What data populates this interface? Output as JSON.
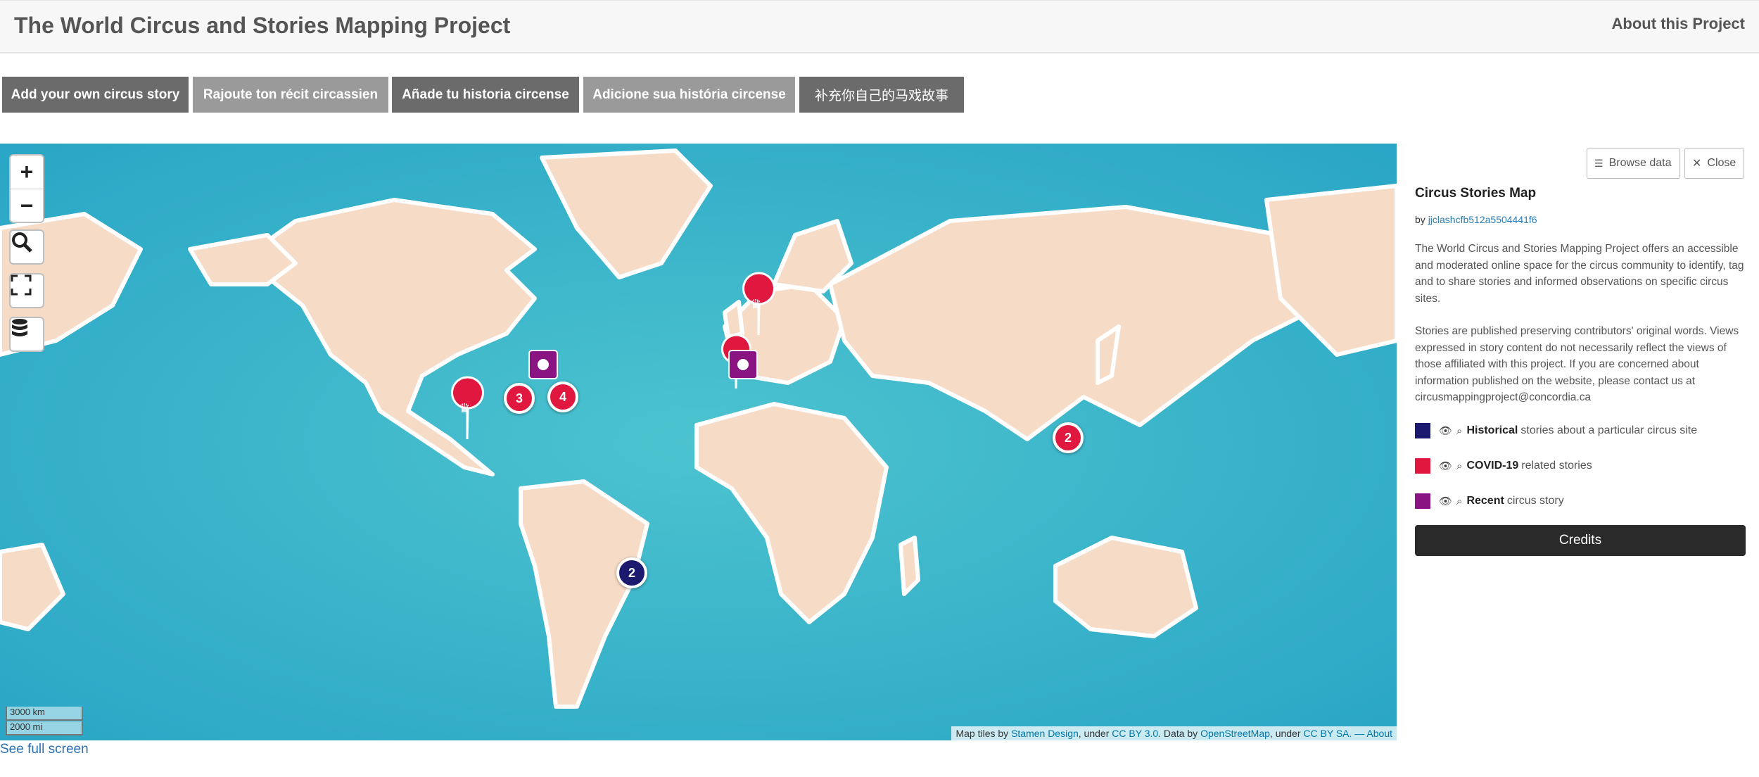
{
  "header": {
    "title": "The World Circus and Stories Mapping Project",
    "about": "About this Project"
  },
  "lang_buttons": [
    "Add your own circus story",
    "Rajoute ton récit circassien",
    "Añade tu historia circense",
    "Adicione sua história circense",
    "补充你自己的马戏故事"
  ],
  "colors": {
    "historical": "#1c1a6e",
    "covid": "#e0173e",
    "recent": "#8a1582",
    "button_dark": "#6b6b6b",
    "button_light": "#9a9a9a"
  },
  "map": {
    "zoom_in": "+",
    "zoom_out": "−",
    "icons": [
      "search-icon",
      "fullscreen-icon",
      "layers-icon"
    ],
    "clusters": [
      {
        "label": "3",
        "category": "covid"
      },
      {
        "label": "4",
        "category": "covid"
      },
      {
        "label": "2",
        "category": "covid"
      },
      {
        "label": "2",
        "category": "historical"
      }
    ],
    "scale": {
      "km": "3000 km",
      "mi": "2000 mi"
    },
    "attribution": {
      "prefix": "Map tiles by",
      "stamen": "Stamen Design",
      "under1": ", under",
      "cc30": "CC BY 3.0",
      "data": ". Data by",
      "osm": "OpenStreetMap",
      "under2": ", under",
      "ccsa": "CC BY SA.",
      "about": "— About"
    }
  },
  "see_full_screen": "See full screen",
  "panel": {
    "browse": "Browse data",
    "close": "Close",
    "title": "Circus Stories Map",
    "by": "by",
    "author": "jjclashcfb512a5504441f6",
    "description1": "The World Circus and Stories Mapping Project offers an accessible and moderated online space for the circus community to identify, tag and to share stories and informed observations on specific circus sites.",
    "description2": "Stories are published preserving contributors' original words. Views expressed in story content do not necessarily reflect the views of those affiliated with this project. If you are concerned about information published on the website, please contact us at circusmappingproject@concordia.ca",
    "legend": [
      {
        "bold": "Historical",
        "rest": "stories about a particular circus site"
      },
      {
        "bold": "COVID-19",
        "rest": "related stories"
      },
      {
        "bold": "Recent",
        "rest": "circus story"
      }
    ],
    "credits": "Credits"
  }
}
